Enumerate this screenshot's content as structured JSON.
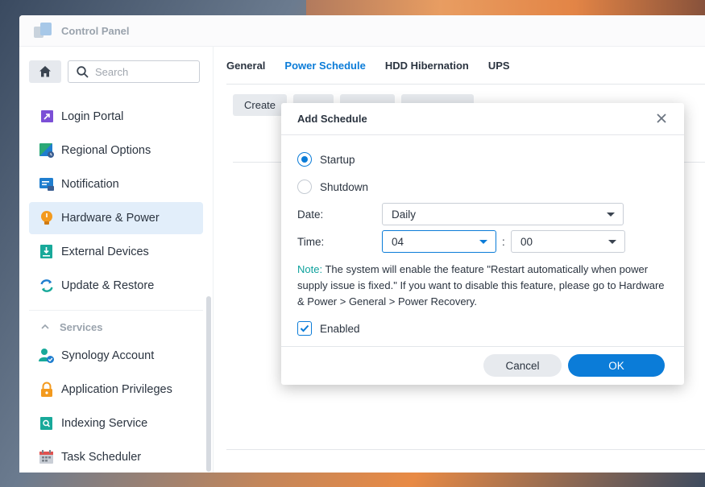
{
  "window": {
    "title": "Control Panel"
  },
  "search": {
    "placeholder": "Search"
  },
  "sidebar": {
    "items": [
      {
        "label": "Login Portal",
        "icon": "login-portal-icon"
      },
      {
        "label": "Regional Options",
        "icon": "regional-options-icon"
      },
      {
        "label": "Notification",
        "icon": "notification-icon"
      },
      {
        "label": "Hardware & Power",
        "icon": "hardware-power-icon",
        "active": true
      },
      {
        "label": "External Devices",
        "icon": "external-devices-icon"
      },
      {
        "label": "Update & Restore",
        "icon": "update-restore-icon"
      }
    ],
    "section": "Services",
    "services": [
      {
        "label": "Synology Account",
        "icon": "synology-account-icon"
      },
      {
        "label": "Application Privileges",
        "icon": "lock-icon"
      },
      {
        "label": "Indexing Service",
        "icon": "indexing-service-icon"
      },
      {
        "label": "Task Scheduler",
        "icon": "calendar-icon"
      }
    ]
  },
  "tabs": [
    {
      "label": "General"
    },
    {
      "label": "Power Schedule",
      "active": true
    },
    {
      "label": "HDD Hibernation"
    },
    {
      "label": "UPS"
    }
  ],
  "toolbar": {
    "create": "Create"
  },
  "dialog": {
    "title": "Add Schedule",
    "startup": "Startup",
    "shutdown": "Shutdown",
    "selected": "Startup",
    "date_label": "Date:",
    "date_value": "Daily",
    "time_label": "Time:",
    "hour": "04",
    "colon": ":",
    "minute": "00",
    "note_label": "Note:",
    "note_text": "The system will enable the feature \"Restart automatically when power supply issue is fixed.\"  If you want to disable this feature, please go to Hardware & Power > General > Power Recovery.",
    "enabled_label": "Enabled",
    "enabled": true,
    "cancel": "Cancel",
    "ok": "OK"
  },
  "colors": {
    "accent": "#0b7cd8",
    "note": "#0fa29d",
    "active_bg": "#e2eefa"
  }
}
